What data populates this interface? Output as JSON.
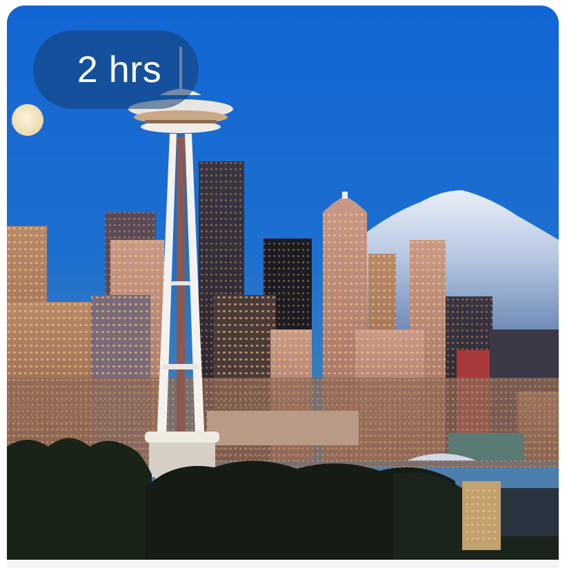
{
  "card": {
    "duration_label": "2 hrs",
    "image_subject": "seattle-skyline-space-needle"
  },
  "colors": {
    "sky_top": "#1570d8",
    "sky_bottom": "#3b83c8",
    "pill_bg": "#1f4a78",
    "duration_text": "#ffffff"
  }
}
